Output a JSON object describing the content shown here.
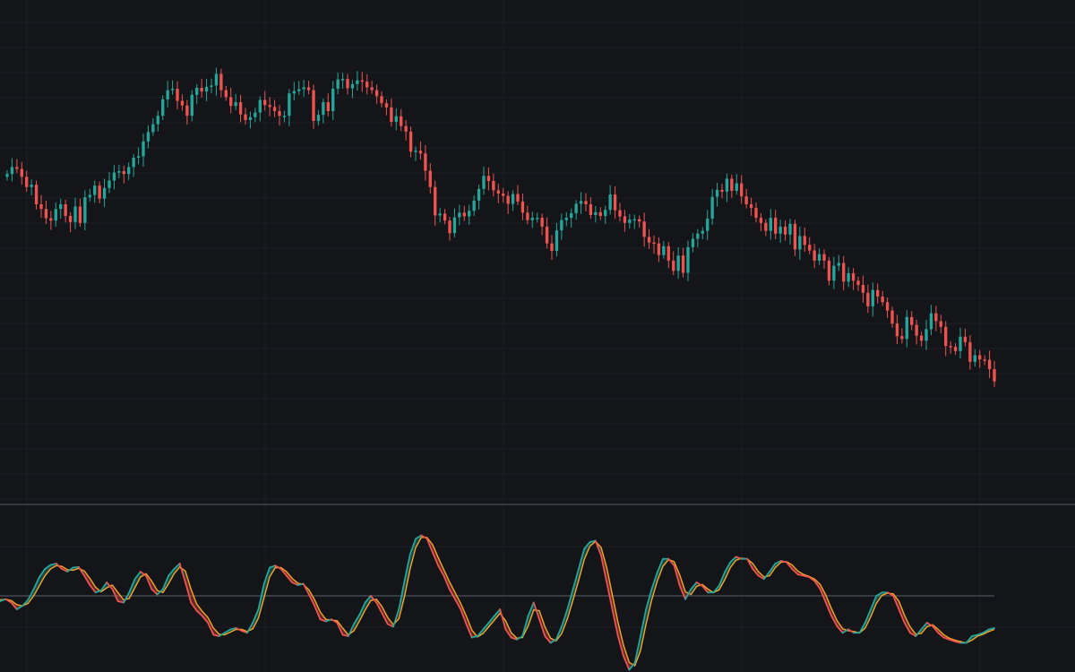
{
  "chart_data": [
    {
      "type": "candlestick",
      "panel": "price",
      "title": "",
      "xlabel": "",
      "ylabel": "",
      "ylim": [
        0,
        1000
      ],
      "x_count": 220,
      "grid": true,
      "colors": {
        "up": "#26a69a",
        "down": "#ef5350",
        "background": "#141519",
        "grid": "#1e2027"
      },
      "closes": [
        665,
        680,
        676,
        659,
        637,
        642,
        600,
        590,
        570,
        565,
        590,
        600,
        575,
        562,
        595,
        560,
        615,
        620,
        640,
        612,
        635,
        651,
        668,
        671,
        665,
        680,
        700,
        703,
        735,
        755,
        772,
        790,
        825,
        845,
        848,
        822,
        812,
        790,
        835,
        850,
        842,
        852,
        855,
        880,
        845,
        830,
        811,
        819,
        793,
        781,
        787,
        797,
        824,
        813,
        809,
        800,
        790,
        790,
        838,
        843,
        847,
        851,
        845,
        779,
        792,
        819,
        800,
        848,
        868,
        869,
        849,
        858,
        866,
        863,
        851,
        845,
        832,
        817,
        808,
        777,
        789,
        768,
        756,
        713,
        715,
        709,
        672,
        637,
        576,
        580,
        565,
        538,
        572,
        582,
        574,
        586,
        608,
        633,
        661,
        650,
        630,
        623,
        618,
        601,
        622,
        606,
        582,
        566,
        571,
        571,
        552,
        516,
        500,
        544,
        566,
        571,
        581,
        601,
        607,
        600,
        577,
        583,
        575,
        588,
        621,
        587,
        574,
        560,
        567,
        568,
        563,
        530,
        518,
        516,
        491,
        510,
        479,
        457,
        490,
        453,
        508,
        526,
        537,
        543,
        569,
        616,
        631,
        627,
        655,
        629,
        645,
        617,
        600,
        592,
        571,
        560,
        543,
        571,
        537,
        552,
        535,
        558,
        503,
        532,
        513,
        501,
        479,
        493,
        479,
        436,
        468,
        474,
        434,
        452,
        436,
        427,
        410,
        381,
        416,
        402,
        390,
        372,
        344,
        317,
        311,
        358,
        341,
        318,
        307,
        332,
        366,
        349,
        337,
        296,
        294,
        285,
        316,
        304,
        262,
        276,
        267,
        266,
        246,
        220
      ]
    },
    {
      "type": "line",
      "panel": "oscillator",
      "title": "",
      "xlabel": "",
      "ylabel": "",
      "ylim": [
        -100,
        100
      ],
      "reference_line": 0,
      "series": [
        {
          "role": "fast",
          "color": "#26a69a"
        },
        {
          "role": "slow",
          "color": "#f5a623"
        }
      ],
      "colors": {
        "fill_up": "#26a69a",
        "fill_down": "#ef5350",
        "fast_up": "#26a69a",
        "fast_down": "#ef5350"
      },
      "fast": [
        -8,
        -5,
        -10,
        -20,
        -15,
        -6,
        10,
        28,
        40,
        46,
        48,
        40,
        36,
        42,
        43,
        30,
        16,
        5,
        8,
        20,
        10,
        -8,
        -10,
        5,
        25,
        36,
        30,
        10,
        2,
        10,
        30,
        40,
        48,
        20,
        -10,
        -22,
        -30,
        -40,
        -58,
        -60,
        -55,
        -50,
        -48,
        -52,
        -55,
        -40,
        -20,
        18,
        42,
        45,
        40,
        30,
        20,
        16,
        18,
        2,
        -15,
        -35,
        -38,
        -35,
        -40,
        -58,
        -60,
        -42,
        -28,
        -10,
        0,
        -10,
        -26,
        -42,
        -46,
        -20,
        22,
        62,
        85,
        90,
        85,
        65,
        45,
        30,
        10,
        -5,
        -20,
        -42,
        -62,
        -60,
        -50,
        -40,
        -30,
        -20,
        -50,
        -62,
        -65,
        -60,
        -30,
        -10,
        -35,
        -60,
        -70,
        -65,
        -45,
        -20,
        10,
        40,
        70,
        80,
        82,
        60,
        20,
        -20,
        -60,
        -90,
        -110,
        -100,
        -60,
        -20,
        10,
        35,
        55,
        55,
        45,
        15,
        -5,
        10,
        20,
        15,
        5,
        5,
        15,
        35,
        50,
        58,
        55,
        55,
        40,
        30,
        25,
        36,
        48,
        52,
        50,
        40,
        32,
        30,
        28,
        22,
        10,
        -10,
        -30,
        -45,
        -55,
        -50,
        -55,
        -55,
        -40,
        -20,
        0,
        5,
        5,
        0,
        -20,
        -40,
        -55,
        -60,
        -50,
        -40,
        -45,
        -55,
        -62,
        -65,
        -68,
        -70,
        -70,
        -60,
        -58,
        -55,
        -50,
        -48
      ],
      "slow": [
        -6,
        -5,
        -7,
        -13,
        -15,
        -11,
        0,
        15,
        30,
        40,
        45,
        44,
        39,
        38,
        41,
        37,
        26,
        13,
        6,
        12,
        16,
        5,
        -6,
        -4,
        12,
        28,
        33,
        22,
        8,
        5,
        18,
        33,
        43,
        37,
        10,
        -12,
        -23,
        -32,
        -48,
        -57,
        -58,
        -54,
        -50,
        -50,
        -53,
        -49,
        -33,
        -3,
        28,
        42,
        42,
        36,
        26,
        19,
        17,
        9,
        -6,
        -24,
        -35,
        -36,
        -37,
        -48,
        -58,
        -52,
        -37,
        -21,
        -7,
        -5,
        -16,
        -32,
        -43,
        -34,
        -1,
        40,
        72,
        87,
        87,
        76,
        57,
        39,
        21,
        5,
        -11,
        -30,
        -51,
        -61,
        -56,
        -46,
        -36,
        -26,
        -37,
        -55,
        -63,
        -62,
        -45,
        -21,
        -22,
        -46,
        -63,
        -67,
        -56,
        -34,
        -6,
        23,
        54,
        74,
        81,
        72,
        42,
        1,
        -39,
        -74,
        -99,
        -104,
        -82,
        -42,
        -6,
        22,
        44,
        54,
        51,
        31,
        6,
        2,
        14,
        17,
        10,
        5,
        9,
        24,
        42,
        53,
        56,
        55,
        48,
        36,
        28,
        30,
        42,
        50,
        51,
        46,
        37,
        32,
        29,
        25,
        17,
        1,
        -19,
        -37,
        -49,
        -52,
        -53,
        -55,
        -48,
        -31,
        -11,
        1,
        4,
        3,
        -8,
        -29,
        -46,
        -57,
        -56,
        -46,
        -43,
        -50,
        -58,
        -63,
        -66,
        -68,
        -70,
        -66,
        -60,
        -57,
        -53,
        -50
      ]
    }
  ]
}
